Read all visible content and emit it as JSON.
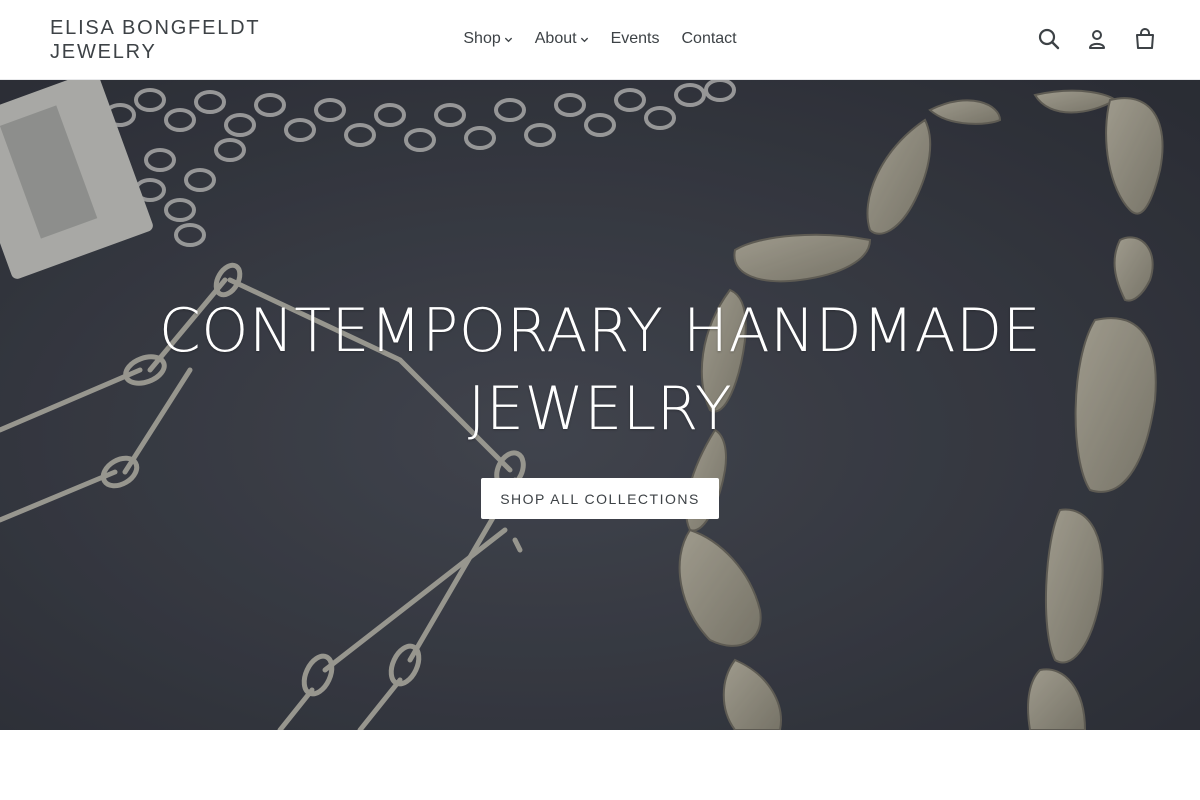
{
  "brand": {
    "name_line1": "ELISA BONGFELDT",
    "name_line2": "JEWELRY"
  },
  "nav": {
    "items": [
      {
        "label": "Shop",
        "has_dropdown": true
      },
      {
        "label": "About",
        "has_dropdown": true
      },
      {
        "label": "Events",
        "has_dropdown": false
      },
      {
        "label": "Contact",
        "has_dropdown": false
      }
    ]
  },
  "header_icons": [
    "search-icon",
    "account-icon",
    "cart-icon"
  ],
  "hero": {
    "title_line1": "CONTEMPORARY HANDMADE",
    "title_line2": "JEWELRY",
    "button_label": "SHOP ALL COLLECTIONS"
  },
  "colors": {
    "text": "#3d4246",
    "header_bg": "#ffffff",
    "hero_bg": "#3c3f48",
    "button_bg": "#ffffff"
  }
}
